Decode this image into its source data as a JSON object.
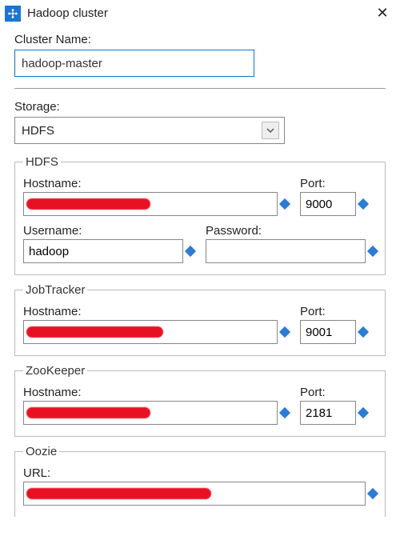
{
  "title": "Hadoop cluster",
  "labels": {
    "cluster_name": "Cluster Name:",
    "storage": "Storage:",
    "hostname": "Hostname:",
    "port": "Port:",
    "username": "Username:",
    "password": "Password:",
    "url": "URL:"
  },
  "cluster_name_value": "hadoop-master",
  "storage_selected": "HDFS",
  "groups": {
    "hdfs": {
      "legend": "HDFS",
      "hostname": "",
      "port": "9000",
      "username": "hadoop",
      "password": ""
    },
    "jobtracker": {
      "legend": "JobTracker",
      "hostname": "",
      "port": "9001"
    },
    "zookeeper": {
      "legend": "ZooKeeper",
      "hostname": "",
      "port": "2181"
    },
    "oozie": {
      "legend": "Oozie",
      "url": ""
    }
  }
}
